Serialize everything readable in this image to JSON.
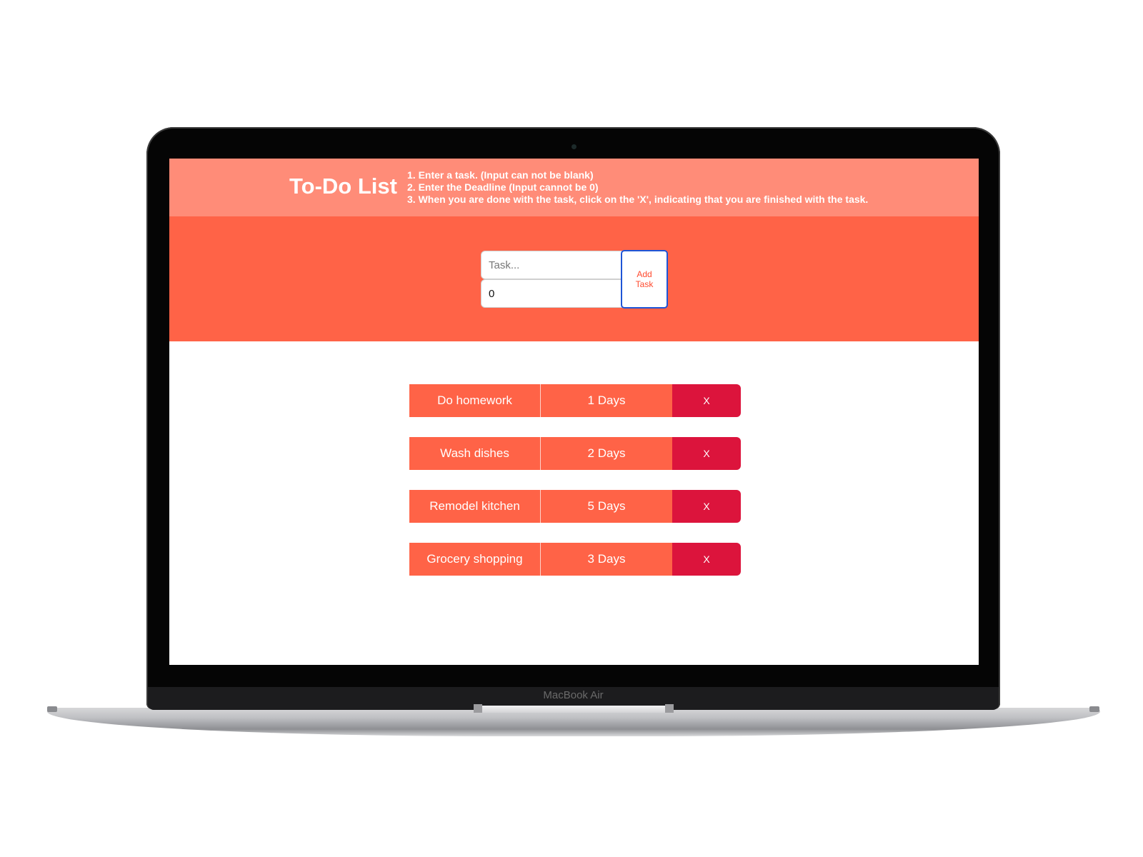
{
  "device": {
    "brand_label": "MacBook Air"
  },
  "app": {
    "title": "To-Do List",
    "instructions": [
      "1. Enter a task. (Input can not be blank)",
      "2. Enter the Deadline (Input cannot be 0)",
      "3. When you are done with the task, click on the 'X', indicating that you are finished with the task."
    ]
  },
  "form": {
    "task_placeholder": "Task...",
    "task_value": "",
    "deadline_value": "0",
    "add_button_label": "Add Task"
  },
  "tasks": [
    {
      "name": "Do homework",
      "deadline": "1 Days",
      "delete_label": "X"
    },
    {
      "name": "Wash dishes",
      "deadline": "2 Days",
      "delete_label": "X"
    },
    {
      "name": "Remodel kitchen",
      "deadline": "5 Days",
      "delete_label": "X"
    },
    {
      "name": "Grocery shopping",
      "deadline": "3 Days",
      "delete_label": "X"
    }
  ],
  "colors": {
    "header": "#ff8c78",
    "input_band": "#ff6347",
    "task_cell": "#ff6347",
    "delete_cell": "#dc143c",
    "add_button_border": "#1f55d6",
    "add_button_text": "#ff4a2e"
  }
}
